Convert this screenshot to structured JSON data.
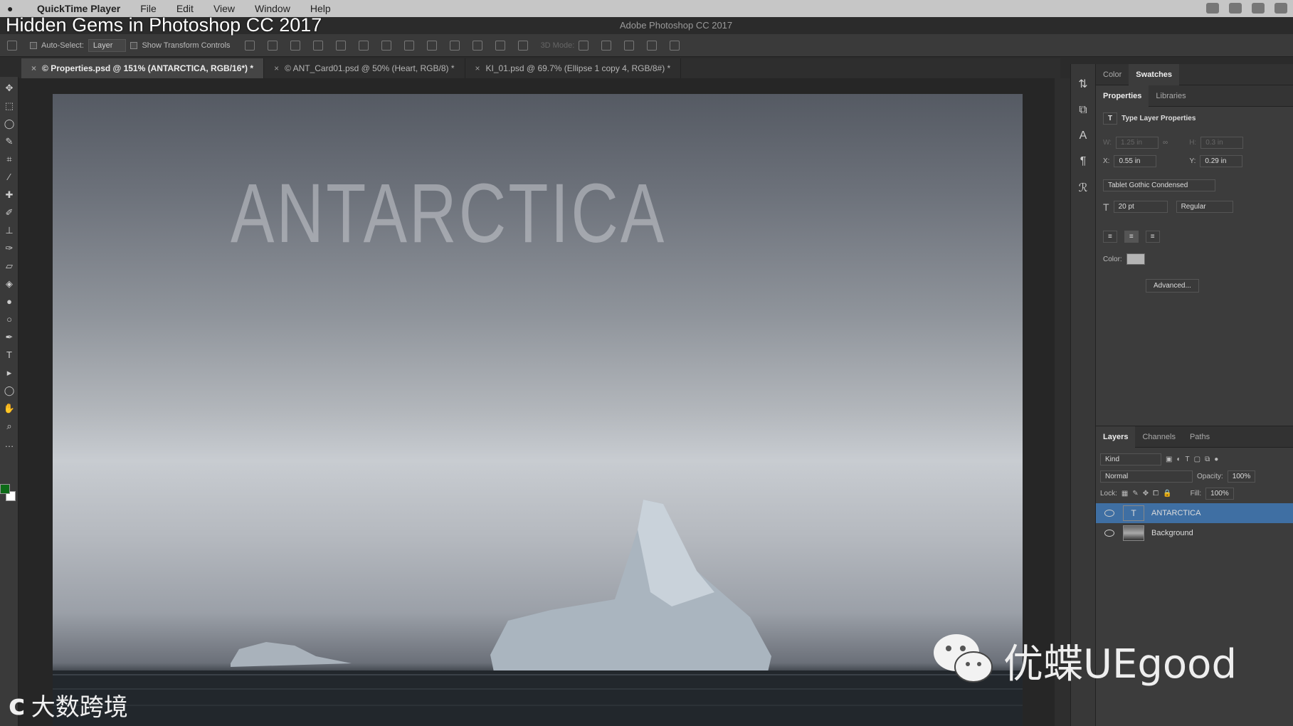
{
  "menubar": {
    "apple": "",
    "app_name": "QuickTime Player",
    "items": [
      "File",
      "Edit",
      "View",
      "Window",
      "Help"
    ]
  },
  "video_title": "Hidden Gems in Photoshop CC 2017",
  "app_title": "Adobe Photoshop CC 2017",
  "options": {
    "auto_select": "Auto-Select:",
    "layer_select": "Layer",
    "show_transform": "Show Transform Controls",
    "mode_3d": "3D Mode:"
  },
  "tabs": [
    {
      "label": "© Properties.psd @ 151% (ANTARCTICA, RGB/16*) *"
    },
    {
      "label": "© ANT_Card01.psd @ 50% (Heart, RGB/8) *"
    },
    {
      "label": "KI_01.psd @ 69.7% (Ellipse 1 copy 4, RGB/8#) *"
    }
  ],
  "canvas": {
    "text": "ANTARCTICA"
  },
  "panel": {
    "top_tabs": [
      "Color",
      "Swatches"
    ],
    "mid_tabs": [
      "Properties",
      "Libraries"
    ],
    "header": "Type Layer Properties",
    "w_label": "W:",
    "w_value": "1.25 in",
    "h_label": "H:",
    "h_value": "0.3 in",
    "x_label": "X:",
    "x_value": "0.55 in",
    "y_label": "Y:",
    "y_value": "0.29 in",
    "font": "Tablet Gothic Condensed",
    "size": "20 pt",
    "style": "Regular",
    "color_label": "Color:",
    "color_value": "#b4b4b4",
    "advanced": "Advanced..."
  },
  "layers": {
    "tabs": [
      "Layers",
      "Channels",
      "Paths"
    ],
    "kind": "Kind",
    "blend": "Normal",
    "opacity_label": "Opacity:",
    "opacity": "100%",
    "lock_label": "Lock:",
    "fill_label": "Fill:",
    "fill": "100%",
    "items": [
      {
        "name": "ANTARCTICA",
        "type": "T"
      },
      {
        "name": "Background",
        "type": ""
      }
    ]
  },
  "overlay": {
    "wechat_text": "优蝶UEgood",
    "brand_text": "大数跨境"
  },
  "colors": {
    "selected": "#3f6fa3",
    "foreground": "#0d6b18"
  }
}
